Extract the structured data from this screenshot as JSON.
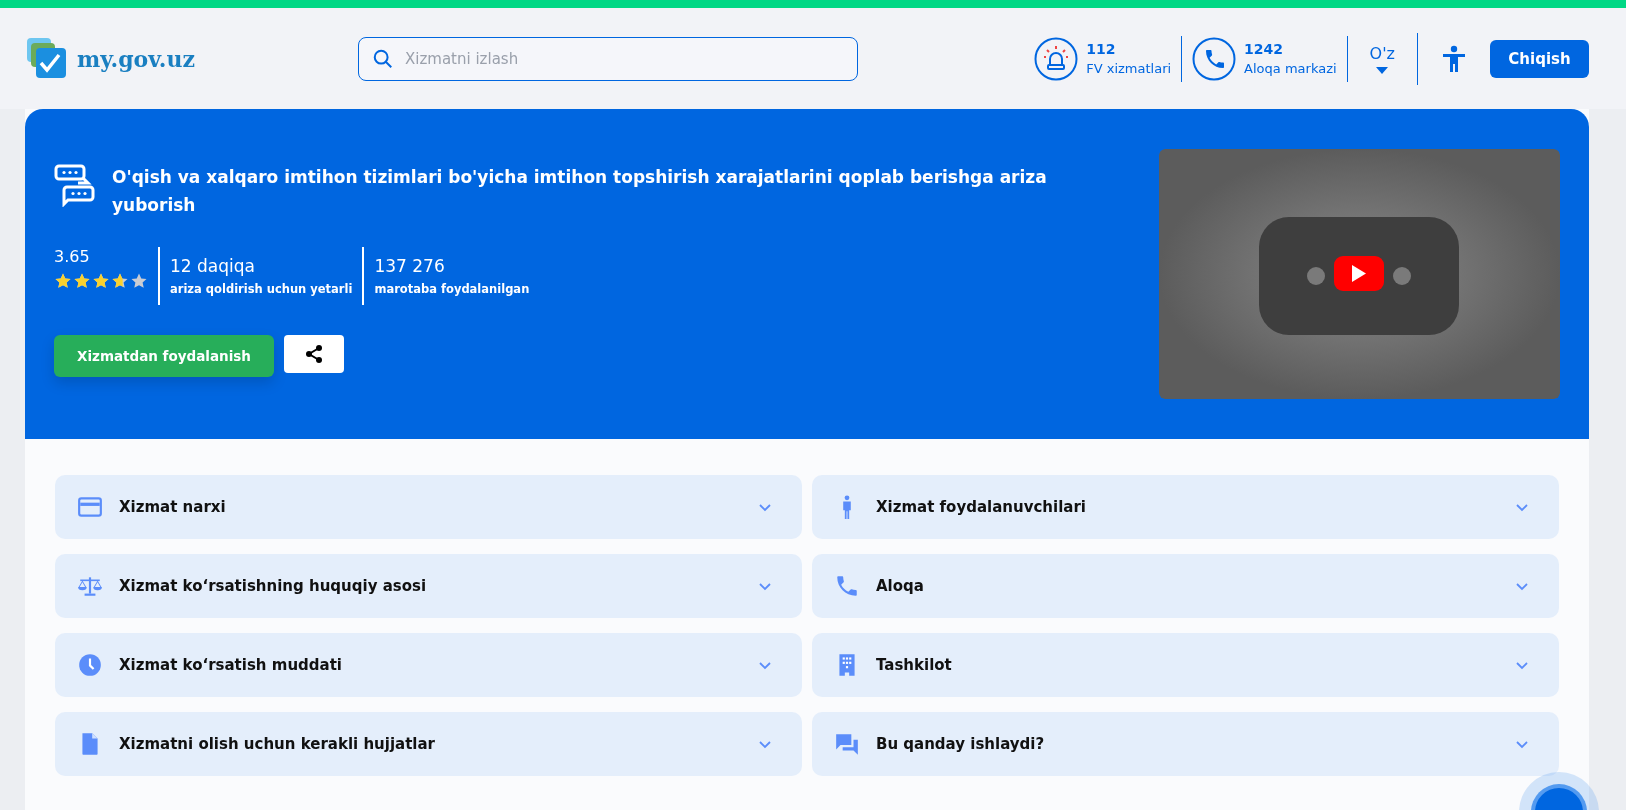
{
  "header": {
    "logo": "my.gov.uz",
    "search": {
      "placeholder": "Xizmatni izlash"
    },
    "contacts": [
      {
        "kind": "siren",
        "number": "112",
        "label": "FV xizmatlari"
      },
      {
        "kind": "phone",
        "number": "1242",
        "label": "Aloqa markazi"
      }
    ],
    "language": "O'z",
    "logout": "Chiqish"
  },
  "service": {
    "title": "O'qish va xalqaro imtihon tizimlari bo'yicha imtihon topshirish xarajatlarini qoplab berishga ariza yuborish",
    "rating": "3.65",
    "stars": 3.65,
    "stats": [
      {
        "value": "12 daqiqa",
        "label": "ariza qoldirish uchun yetarli"
      },
      {
        "value": "137 276",
        "label": "marotaba foydalanilgan"
      }
    ],
    "use_button": "Xizmatdan foydalanish"
  },
  "sections": [
    {
      "kind": "card",
      "label": "Xizmat narxi",
      "expanded": false
    },
    {
      "kind": "person",
      "label": "Xizmat foydalanuvchilari",
      "expanded": false
    },
    {
      "kind": "scales",
      "label": "Xizmat koʻrsatishning huquqiy asosi",
      "expanded": false
    },
    {
      "kind": "phone",
      "label": "Aloqa",
      "expanded": false
    },
    {
      "kind": "clock",
      "label": "Xizmat koʻrsatish muddati",
      "expanded": false
    },
    {
      "kind": "building",
      "label": "Tashkilot",
      "expanded": false
    },
    {
      "kind": "document",
      "label": "Xizmatni olish uchun kerakli hujjatlar",
      "expanded": false
    },
    {
      "kind": "chat",
      "label": "Bu qanday ishlaydi?",
      "expanded": false
    }
  ]
}
